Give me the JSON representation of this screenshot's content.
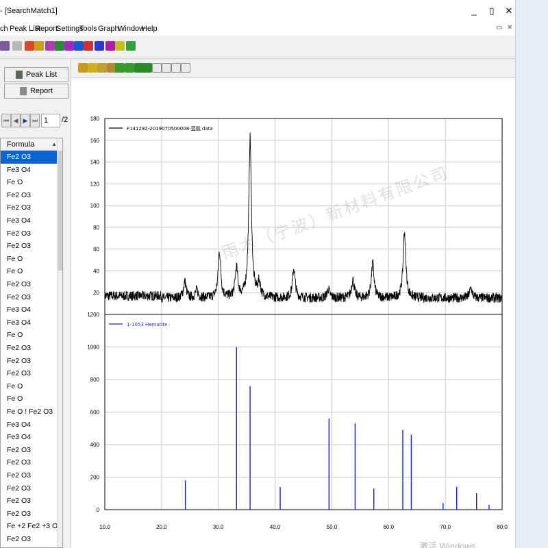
{
  "window": {
    "title": "- [SearchMatch1]",
    "minimize_glyph": "_",
    "restore_glyph": "▯",
    "close_glyph": "✕",
    "mdi_restore_glyph": "▭",
    "mdi_close_glyph": "✕"
  },
  "menu": [
    "ch",
    "Peak List",
    "Report",
    "Settings",
    "Tools",
    "Graph",
    "Window",
    "Help"
  ],
  "panel": {
    "tab_peak_list": "Peak List",
    "tab_report": "Report",
    "page_value": "1",
    "page_total": "/2",
    "column_header": "Formula",
    "rows": [
      "Fe2 O3",
      "Fe3 O4",
      "Fe O",
      "Fe2 O3",
      "Fe2 O3",
      "Fe3 O4",
      "Fe2 O3",
      "Fe2 O3",
      "Fe O",
      "Fe O",
      "Fe2 O3",
      "Fe2 O3",
      "Fe3 O4",
      "Fe3 O4",
      "Fe O",
      "Fe2 O3",
      "Fe2 O3",
      "Fe2 O3",
      "Fe O",
      "Fe O",
      "Fe O ! Fe2 O3",
      "Fe3 O4",
      "Fe3 O4",
      "Fe2 O3",
      "Fe2 O3",
      "Fe2 O3",
      "Fe2 O3",
      "Fe2 O3",
      "Fe2 O3",
      "Fe +2 Fe2 +3 O4",
      "Fe2 O3"
    ],
    "selected_index": 0
  },
  "watermark": "雨木（宁波）新材料有限公司",
  "os_overlay": "激活 Windows",
  "colors": {
    "selection": "#0a64d2",
    "measured_line": "#000000",
    "reference_line": "#1a1ad8",
    "grid": "#c8c8c8"
  },
  "chart_data": [
    {
      "type": "line",
      "legend": "F141282-2019070500008-蓝肌 data",
      "x_ticks": [
        "10.0",
        "20.0",
        "30.0",
        "40.0",
        "50.0",
        "60.0",
        "70.0",
        "80.0"
      ],
      "y_ticks": [
        "20",
        "40",
        "60",
        "80",
        "100",
        "120",
        "140",
        "160",
        "180"
      ],
      "xlim": [
        10,
        80
      ],
      "ylim": [
        0,
        180
      ],
      "grid": true,
      "baseline": 15,
      "peaks": [
        {
          "x": 24.1,
          "y": 30
        },
        {
          "x": 26.2,
          "y": 22
        },
        {
          "x": 30.2,
          "y": 57
        },
        {
          "x": 33.2,
          "y": 42
        },
        {
          "x": 35.6,
          "y": 162
        },
        {
          "x": 37.2,
          "y": 28
        },
        {
          "x": 43.3,
          "y": 42
        },
        {
          "x": 49.4,
          "y": 23
        },
        {
          "x": 53.7,
          "y": 32
        },
        {
          "x": 57.2,
          "y": 47
        },
        {
          "x": 62.8,
          "y": 76
        },
        {
          "x": 74.5,
          "y": 24
        }
      ]
    },
    {
      "type": "bar",
      "legend": "1-1053 Hematite",
      "x_ticks": [
        "10.0",
        "20.0",
        "30.0",
        "40.0",
        "50.0",
        "60.0",
        "70.0",
        "80.0"
      ],
      "y_ticks": [
        "0",
        "200",
        "400",
        "600",
        "800",
        "1000",
        "1200"
      ],
      "xlim": [
        10,
        80
      ],
      "ylim": [
        0,
        1200
      ],
      "grid": true,
      "sticks": [
        {
          "x": 24.2,
          "y": 180
        },
        {
          "x": 33.2,
          "y": 1000
        },
        {
          "x": 35.6,
          "y": 760
        },
        {
          "x": 40.9,
          "y": 140
        },
        {
          "x": 49.5,
          "y": 560
        },
        {
          "x": 54.1,
          "y": 530
        },
        {
          "x": 57.4,
          "y": 130
        },
        {
          "x": 62.5,
          "y": 490
        },
        {
          "x": 64.0,
          "y": 460
        },
        {
          "x": 69.6,
          "y": 40
        },
        {
          "x": 72.0,
          "y": 140
        },
        {
          "x": 75.5,
          "y": 100
        },
        {
          "x": 77.7,
          "y": 30
        }
      ]
    }
  ]
}
